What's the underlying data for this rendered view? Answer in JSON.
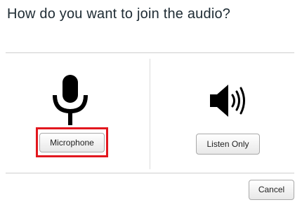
{
  "dialog": {
    "title": "How do you want to join the audio?"
  },
  "options": {
    "microphone": {
      "icon": "microphone-icon",
      "label": "Microphone",
      "highlight_color": "#e2171e"
    },
    "listen_only": {
      "icon": "speaker-icon",
      "label": "Listen Only"
    }
  },
  "footer": {
    "cancel_label": "Cancel"
  }
}
